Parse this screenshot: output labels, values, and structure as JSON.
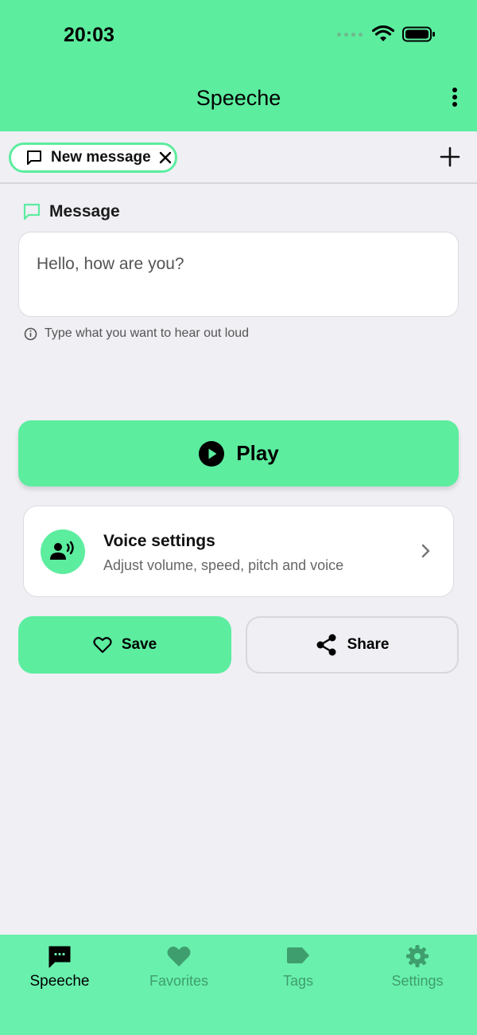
{
  "status_bar": {
    "time": "20:03"
  },
  "header": {
    "title": "Speeche"
  },
  "tabs": {
    "active_tab_label": "New message"
  },
  "message": {
    "section_label": "Message",
    "value": "Hello, how are you?",
    "hint": "Type what you want to hear out loud"
  },
  "play": {
    "label": "Play"
  },
  "voice_settings": {
    "title": "Voice settings",
    "subtitle": "Adjust volume, speed, pitch and voice"
  },
  "actions": {
    "save_label": "Save",
    "share_label": "Share"
  },
  "bottom_nav": {
    "items": [
      {
        "label": "Speeche",
        "icon": "chat-bubble-icon",
        "active": true
      },
      {
        "label": "Favorites",
        "icon": "heart-icon",
        "active": false
      },
      {
        "label": "Tags",
        "icon": "tag-icon",
        "active": false
      },
      {
        "label": "Settings",
        "icon": "gear-icon",
        "active": false
      }
    ]
  },
  "colors": {
    "accent": "#5ced9f",
    "background": "#efeff4",
    "inactive_nav": "#3f9e6e"
  }
}
